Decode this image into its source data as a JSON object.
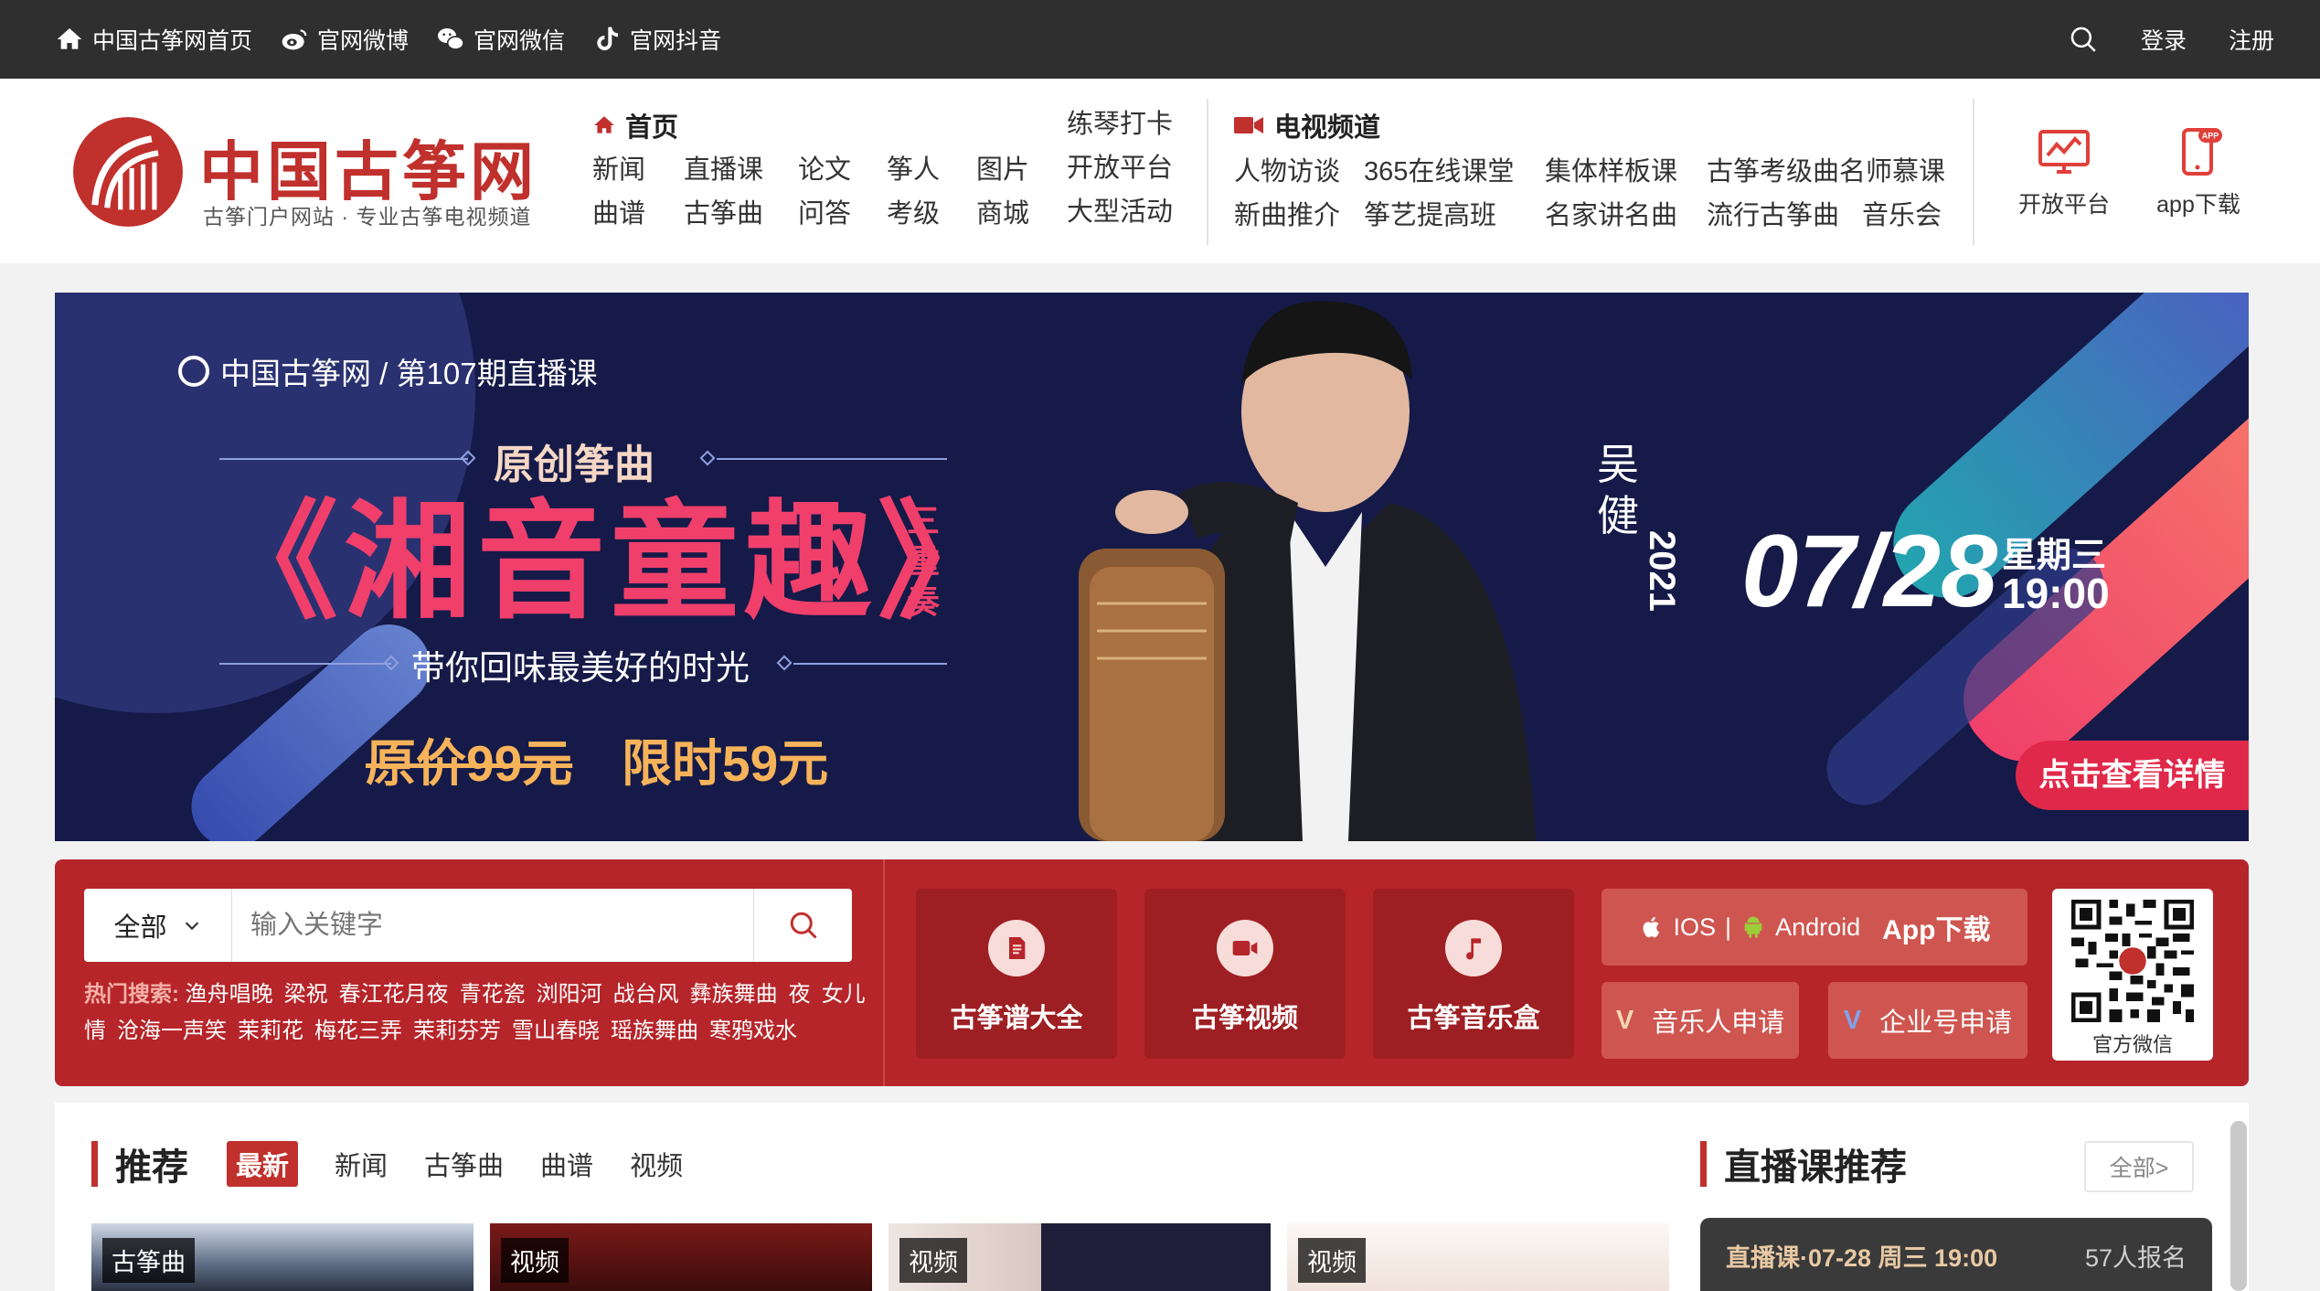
{
  "topbar": {
    "links": [
      {
        "label": "中国古筝网首页",
        "icon": "home-icon"
      },
      {
        "label": "官网微博",
        "icon": "weibo-icon"
      },
      {
        "label": "官网微信",
        "icon": "wechat-icon"
      },
      {
        "label": "官网抖音",
        "icon": "douyin-icon"
      }
    ],
    "login": "登录",
    "register": "注册"
  },
  "logo": {
    "name": "中国古筝网",
    "slogan": "古筝门户网站 · 专业古筝电视频道"
  },
  "nav": {
    "home": "首页",
    "col1": [
      "新闻",
      "曲谱"
    ],
    "col2": [
      "直播课",
      "古筝曲"
    ],
    "col3": [
      "论文",
      "问答"
    ],
    "col4": [
      "筝人",
      "考级"
    ],
    "col5": [
      "图片",
      "商城"
    ],
    "col6": [
      "练琴打卡",
      "开放平台",
      "大型活动"
    ]
  },
  "tv": {
    "title": "电视频道",
    "row1": [
      "人物访谈",
      "365在线课堂",
      "集体样板课",
      "古筝考级曲名师慕课"
    ],
    "row2": [
      "新曲推介",
      "筝艺提高班",
      "名家讲名曲",
      "流行古筝曲",
      "音乐会"
    ]
  },
  "header_icons": {
    "open_platform": "开放平台",
    "app_download": "app下载"
  },
  "banner": {
    "brand": "中国古筝网 / 第107期直播课",
    "subtitle": "原创筝曲",
    "title": "《湘音童趣》",
    "vertical": "三重奏",
    "tagline": "带你回味最美好的时光",
    "old_price": "原价99元",
    "new_price": "限时59元",
    "teacher": "吴健",
    "year": "2021",
    "date": "07/28",
    "weekday": "星期三",
    "time": "19:00",
    "cta": "点击查看详情"
  },
  "search": {
    "scope": "全部",
    "placeholder": "输入关键字",
    "hot_label": "热门搜索:",
    "hot_terms": [
      "渔舟唱晚",
      "梁祝",
      "春江花月夜",
      "青花瓷",
      "浏阳河",
      "战台风",
      "彝族舞曲",
      "夜",
      "女儿情",
      "沧海一声笑",
      "茉莉花",
      "梅花三弄",
      "茉莉芬芳",
      "雪山春晓",
      "瑶族舞曲",
      "寒鸦戏水"
    ]
  },
  "quick": [
    {
      "label": "古筝谱大全",
      "icon": "score-icon"
    },
    {
      "label": "古筝视频",
      "icon": "video-camera-icon"
    },
    {
      "label": "古筝音乐盒",
      "icon": "music-note-icon"
    }
  ],
  "app": {
    "ios": "IOS",
    "sep": "|",
    "android": "Android",
    "download": "App下载"
  },
  "apply": {
    "musician": "音乐人申请",
    "enterprise": "企业号申请",
    "v": "V"
  },
  "qr": {
    "label": "官方微信"
  },
  "recommend": {
    "title": "推荐",
    "tabs": [
      "最新",
      "新闻",
      "古筝曲",
      "曲谱",
      "视频"
    ],
    "cards": [
      "古筝曲",
      "视频",
      "视频",
      "视频"
    ]
  },
  "live": {
    "title": "直播课推荐",
    "more": "全部>",
    "item": {
      "info": "直播课·07-28 周三 19:00",
      "count": "57人报名"
    }
  },
  "colors": {
    "brand_red": "#c0302d",
    "band_red": "#b6252a",
    "banner_bg": "#151a48",
    "accent_pink": "#f03f6b",
    "price_orange": "#f7b35a"
  }
}
